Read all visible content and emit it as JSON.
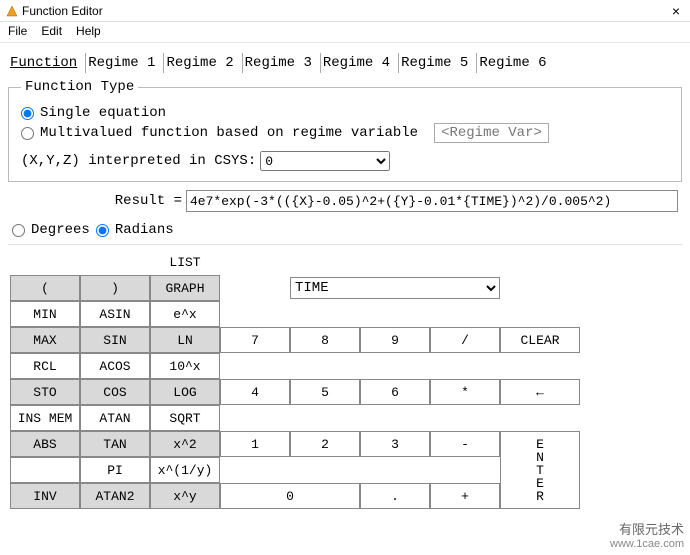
{
  "window": {
    "title": "Function Editor",
    "close_glyph": "×"
  },
  "menu": {
    "file": "File",
    "edit": "Edit",
    "help": "Help"
  },
  "tabs": [
    "Function",
    "Regime 1",
    "Regime 2",
    "Regime 3",
    "Regime 4",
    "Regime 5",
    "Regime 6"
  ],
  "function_type": {
    "legend": "Function Type",
    "single": "Single equation",
    "multi": "Multivalued function based on regime variable",
    "regime_var_placeholder": "<Regime Var>",
    "csys_label": "(X,Y,Z) interpreted in CSYS:",
    "csys_value": "0"
  },
  "result": {
    "label": "Result =",
    "value": "4e7*exp(-3*(({X}-0.05)^2+({Y}-0.01*{TIME})^2)/0.005^2)"
  },
  "angle_mode": {
    "degrees": "Degrees",
    "radians": "Radians"
  },
  "var_dropdown": "TIME",
  "labels": {
    "list": "LIST",
    "min": "MIN",
    "asin": "ASIN",
    "ex": "e^x",
    "rcl": "RCL",
    "acos": "ACOS",
    "tenx": "10^x",
    "insmem": "INS MEM",
    "atan": "ATAN",
    "sqrt": "SQRT",
    "pi": "PI",
    "xy1": "x^(1/y)"
  },
  "buttons": {
    "lparen": "(",
    "rparen": ")",
    "graph": "GRAPH",
    "max": "MAX",
    "sin": "SIN",
    "ln": "LN",
    "sto": "STO",
    "cos": "COS",
    "log": "LOG",
    "abs": "ABS",
    "tan": "TAN",
    "x2": "x^2",
    "inv": "INV",
    "atan2": "ATAN2",
    "xy": "x^y",
    "d7": "7",
    "d8": "8",
    "d9": "9",
    "div": "/",
    "clear": "CLEAR",
    "d4": "4",
    "d5": "5",
    "d6": "6",
    "mul": "*",
    "back": "←",
    "d1": "1",
    "d2": "2",
    "d3": "3",
    "sub": "-",
    "d0": "0",
    "dot": ".",
    "add": "+",
    "enter": "E\nN\nT\nE\nR"
  },
  "watermark": {
    "cn": "有限元技术",
    "url": "www.1cae.com"
  }
}
